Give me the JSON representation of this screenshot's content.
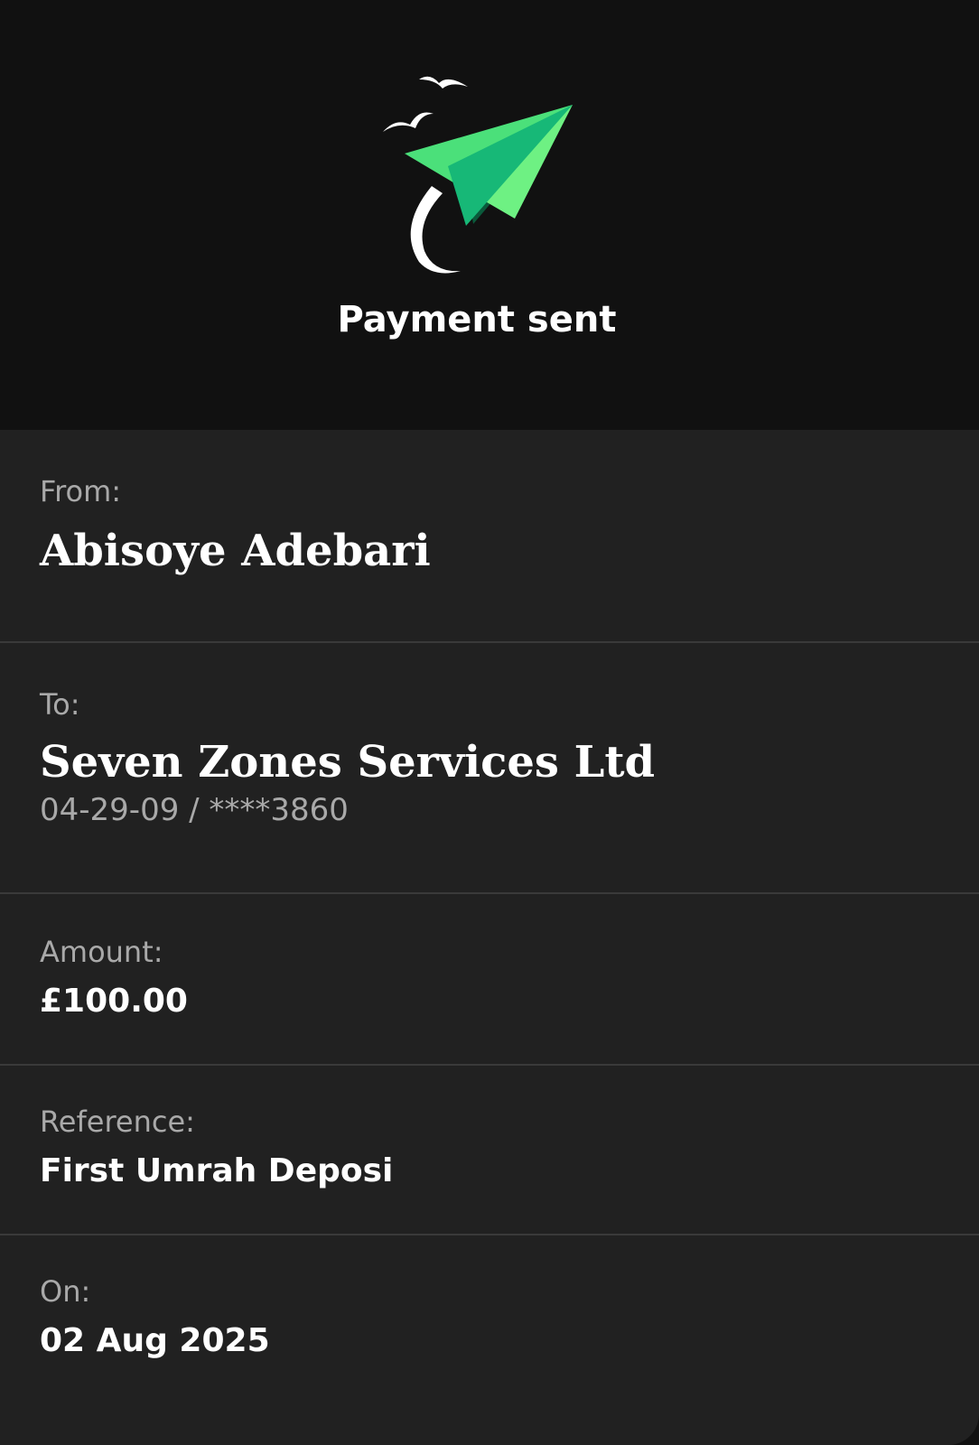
{
  "header": {
    "title": "Payment sent",
    "icon": "paper-plane-icon",
    "accent_color": "#4be07a"
  },
  "details": {
    "from": {
      "label": "From:",
      "value": "Abisoye Adebari"
    },
    "to": {
      "label": "To:",
      "value": "Seven Zones Services Ltd",
      "account": "04-29-09 / ****3860"
    },
    "amount": {
      "label": "Amount:",
      "value": "£100.00"
    },
    "reference": {
      "label": "Reference:",
      "value": "First Umrah Deposi"
    },
    "date": {
      "label": "On:",
      "value": "02 Aug 2025"
    }
  }
}
